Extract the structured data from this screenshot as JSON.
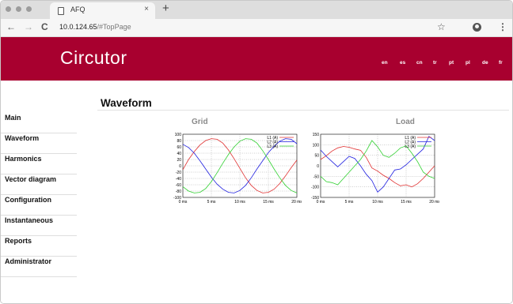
{
  "browser": {
    "tab_title": "AFQ",
    "tab_close": "×",
    "new_tab": "+",
    "back": "←",
    "forward": "→",
    "reload": "C",
    "url_host": "10.0.124.65",
    "url_path": "/#TopPage",
    "star": "☆",
    "menu": "⋮"
  },
  "header": {
    "logo": "Circutor",
    "languages": [
      "en",
      "es",
      "cn",
      "tr",
      "pt",
      "pl",
      "de",
      "fr"
    ]
  },
  "sidebar": {
    "items": [
      "Main",
      "Waveform",
      "Harmonics",
      "Vector diagram",
      "Configuration",
      "Instantaneous",
      "Reports",
      "Administrator"
    ]
  },
  "main": {
    "title": "Waveform"
  },
  "colors": {
    "brand": "#a8002f",
    "L1": "#e03030",
    "L2": "#2020e0",
    "L3": "#30d030"
  },
  "chart_data": [
    {
      "type": "line",
      "title": "Grid",
      "ylim": [
        -100,
        100
      ],
      "yticks": [
        "100",
        "80",
        "60",
        "40",
        "20",
        "0",
        "-20",
        "-40",
        "-60",
        "-80",
        "-100"
      ],
      "xticks": [
        "0 ms",
        "5 ms",
        "10 ms",
        "15 ms",
        "20 ms"
      ],
      "grid": true,
      "legend_position": "top-right",
      "x": [
        0,
        1,
        2,
        3,
        4,
        5,
        6,
        7,
        8,
        9,
        10,
        11,
        12,
        13,
        14,
        15,
        16,
        17,
        18,
        19,
        20
      ],
      "series": [
        {
          "name": "L1 (A)",
          "color": "#e03030",
          "values": [
            -12,
            20,
            45,
            66,
            80,
            86,
            84,
            72,
            50,
            22,
            -8,
            -38,
            -62,
            -78,
            -86,
            -84,
            -74,
            -56,
            -32,
            -6,
            18
          ]
        },
        {
          "name": "L2 (A)",
          "color": "#2020e0",
          "values": [
            68,
            58,
            40,
            16,
            -10,
            -36,
            -58,
            -74,
            -84,
            -86,
            -78,
            -62,
            -38,
            -10,
            16,
            42,
            62,
            78,
            86,
            84,
            70
          ]
        },
        {
          "name": "L3 (A)",
          "color": "#30d030",
          "values": [
            -66,
            -80,
            -86,
            -84,
            -72,
            -50,
            -22,
            8,
            36,
            60,
            78,
            86,
            84,
            72,
            48,
            20,
            -10,
            -38,
            -62,
            -78,
            -86
          ]
        }
      ]
    },
    {
      "type": "line",
      "title": "Load",
      "ylim": [
        -150,
        150
      ],
      "yticks": [
        "150",
        "100",
        "50",
        "0",
        "-50",
        "-100",
        "-150"
      ],
      "xticks": [
        "0 ms",
        "5 ms",
        "10 ms",
        "15 ms",
        "20 ms"
      ],
      "grid": true,
      "legend_position": "top-right",
      "x": [
        0,
        1,
        2,
        3,
        4,
        5,
        6,
        7,
        8,
        9,
        10,
        11,
        12,
        13,
        14,
        15,
        16,
        17,
        18,
        19,
        20
      ],
      "series": [
        {
          "name": "L1 (A)",
          "color": "#e03030",
          "values": [
            30,
            48,
            70,
            85,
            92,
            88,
            80,
            74,
            40,
            -10,
            -25,
            -45,
            -60,
            -80,
            -95,
            -90,
            -100,
            -85,
            -60,
            -30,
            0
          ]
        },
        {
          "name": "L2 (A)",
          "color": "#2020e0",
          "values": [
            75,
            45,
            20,
            -5,
            20,
            45,
            35,
            0,
            -40,
            -70,
            -125,
            -100,
            -60,
            -20,
            -15,
            5,
            30,
            55,
            80,
            140,
            120
          ]
        },
        {
          "name": "L3 (A)",
          "color": "#30d030",
          "values": [
            -50,
            -75,
            -80,
            -90,
            -60,
            -30,
            0,
            30,
            70,
            120,
            90,
            50,
            40,
            60,
            85,
            95,
            60,
            20,
            -30,
            -50,
            -60
          ]
        }
      ]
    }
  ]
}
